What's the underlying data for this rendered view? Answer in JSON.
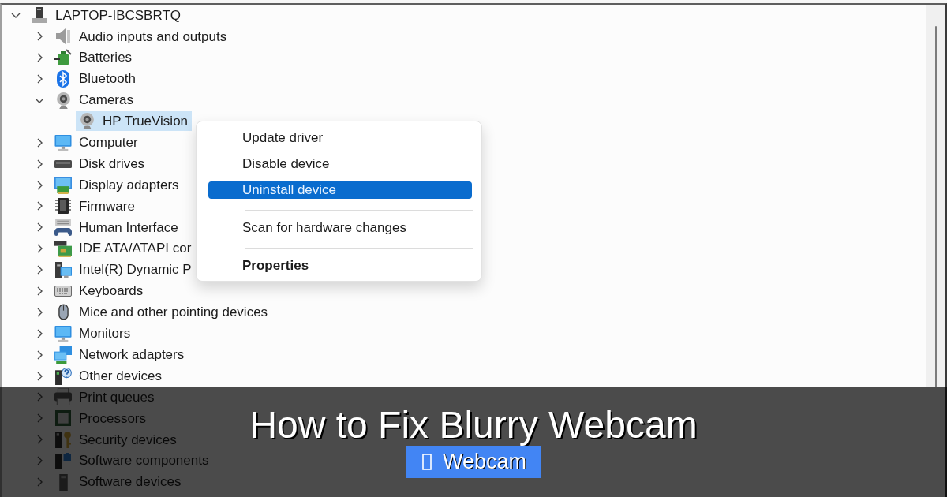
{
  "tree": {
    "label": "LAPTOP-IBCSBRTQ",
    "expanded": true,
    "selected": false,
    "children": [
      {
        "label": "Audio inputs and outputs",
        "expanded": false,
        "selected": false
      },
      {
        "label": "Batteries",
        "expanded": false,
        "selected": false
      },
      {
        "label": "Bluetooth",
        "expanded": false,
        "selected": false
      },
      {
        "label": "Cameras",
        "expanded": true,
        "selected": false,
        "children": [
          {
            "label": "HP TrueVision",
            "selected": true
          }
        ]
      },
      {
        "label": "Computer",
        "expanded": false,
        "selected": false
      },
      {
        "label": "Disk drives",
        "expanded": false,
        "selected": false
      },
      {
        "label": "Display adapters",
        "expanded": false,
        "selected": false
      },
      {
        "label": "Firmware",
        "expanded": false,
        "selected": false
      },
      {
        "label": "Human Interface",
        "expanded": false,
        "selected": false
      },
      {
        "label": "IDE ATA/ATAPI cor",
        "expanded": false,
        "selected": false
      },
      {
        "label": "Intel(R) Dynamic P",
        "expanded": false,
        "selected": false
      },
      {
        "label": "Keyboards",
        "expanded": false,
        "selected": false
      },
      {
        "label": "Mice and other pointing devices",
        "expanded": false,
        "selected": false
      },
      {
        "label": "Monitors",
        "expanded": false,
        "selected": false
      },
      {
        "label": "Network adapters",
        "expanded": false,
        "selected": false
      },
      {
        "label": "Other devices",
        "expanded": false,
        "selected": false
      },
      {
        "label": "Print queues",
        "expanded": false,
        "selected": false
      },
      {
        "label": "Processors",
        "expanded": false,
        "selected": false
      },
      {
        "label": "Security devices",
        "expanded": false,
        "selected": false
      },
      {
        "label": "Software components",
        "expanded": false,
        "selected": false
      },
      {
        "label": "Software devices",
        "expanded": false,
        "selected": false
      }
    ]
  },
  "context_menu": {
    "items": [
      {
        "kind": "item",
        "label": "Update driver",
        "selected": false,
        "default": false
      },
      {
        "kind": "item",
        "label": "Disable device",
        "selected": false,
        "default": false
      },
      {
        "kind": "item",
        "label": "Uninstall device",
        "selected": true,
        "default": false
      },
      {
        "kind": "separator"
      },
      {
        "kind": "item",
        "label": "Scan for hardware changes",
        "selected": false,
        "default": false
      },
      {
        "kind": "separator"
      },
      {
        "kind": "item",
        "label": "Properties",
        "selected": false,
        "default": true
      }
    ]
  },
  "banner": {
    "title": "How to Fix Blurry Webcam",
    "tag": "Webcam"
  }
}
